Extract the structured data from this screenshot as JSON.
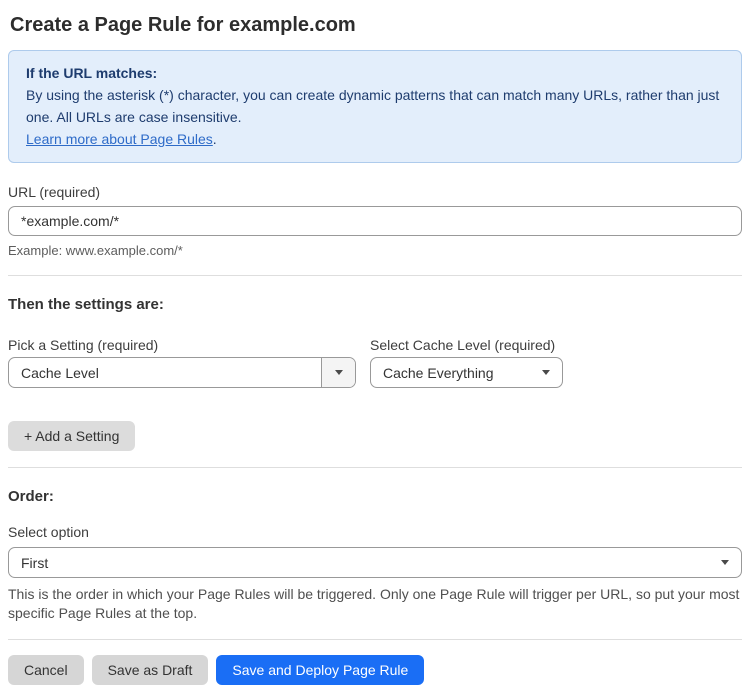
{
  "page": {
    "title": "Create a Page Rule for example.com"
  },
  "info_box": {
    "heading": "If the URL matches:",
    "body": "By using the asterisk (*) character, you can create dynamic patterns that can match many URLs, rather than just one. All URLs are case insensitive.",
    "link_label": "Learn more about Page Rules",
    "link_suffix": "."
  },
  "url_field": {
    "label": "URL (required)",
    "value": "*example.com/*",
    "helper": "Example: www.example.com/*"
  },
  "settings_section": {
    "heading": "Then the settings are:",
    "setting_picker": {
      "label": "Pick a Setting (required)",
      "value": "Cache Level"
    },
    "cache_level_picker": {
      "label": "Select Cache Level (required)",
      "value": "Cache Everything"
    },
    "add_setting_label": "+ Add a Setting"
  },
  "order_section": {
    "heading": "Order:",
    "label": "Select option",
    "value": "First",
    "helper": "This is the order in which your Page Rules will be triggered. Only one Page Rule will trigger per URL, so put your most specific Page Rules at the top."
  },
  "actions": {
    "cancel": "Cancel",
    "save_draft": "Save as Draft",
    "save_deploy": "Save and Deploy Page Rule"
  },
  "colors": {
    "accent_blue": "#1a6ef5",
    "info_bg": "#e3eefb",
    "info_border": "#aecbec",
    "info_text": "#1e3c6e",
    "link_blue": "#2e6bc8"
  }
}
